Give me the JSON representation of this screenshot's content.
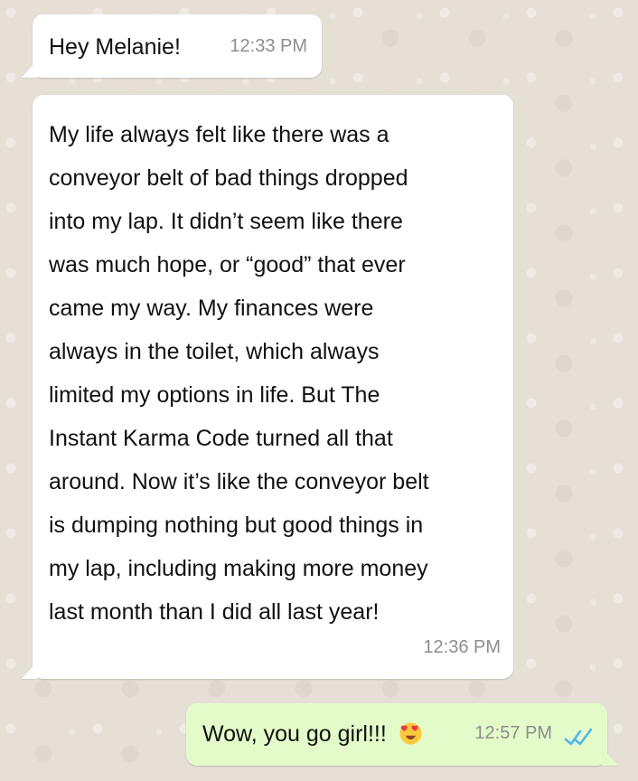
{
  "chat": {
    "messages": [
      {
        "direction": "incoming",
        "text": "Hey Melanie!",
        "time": "12:33 PM"
      },
      {
        "direction": "incoming",
        "text": "My life always felt like there was a\nconveyor belt of bad things dropped\ninto my lap. It didn’t seem like there\nwas much hope, or “good” that ever\ncame my way. My finances were\nalways in the toilet, which always\nlimited my options in life. But The\nInstant Karma Code turned all that\naround. Now it’s like the conveyor belt\nis dumping nothing but good things in\nmy lap, including making more money\nlast month than I did all last year!",
        "time": "12:36 PM"
      },
      {
        "direction": "outgoing",
        "text": "Wow, you go girl!!!",
        "emoji": "😍",
        "time": "12:57 PM",
        "status_icon": "double-check-icon"
      }
    ]
  },
  "colors": {
    "background": "#e6dfd6",
    "incoming_bubble": "#ffffff",
    "outgoing_bubble": "#e3fbc9",
    "timestamp": "#8d8d8d",
    "read_receipt": "#4fb6ec"
  }
}
